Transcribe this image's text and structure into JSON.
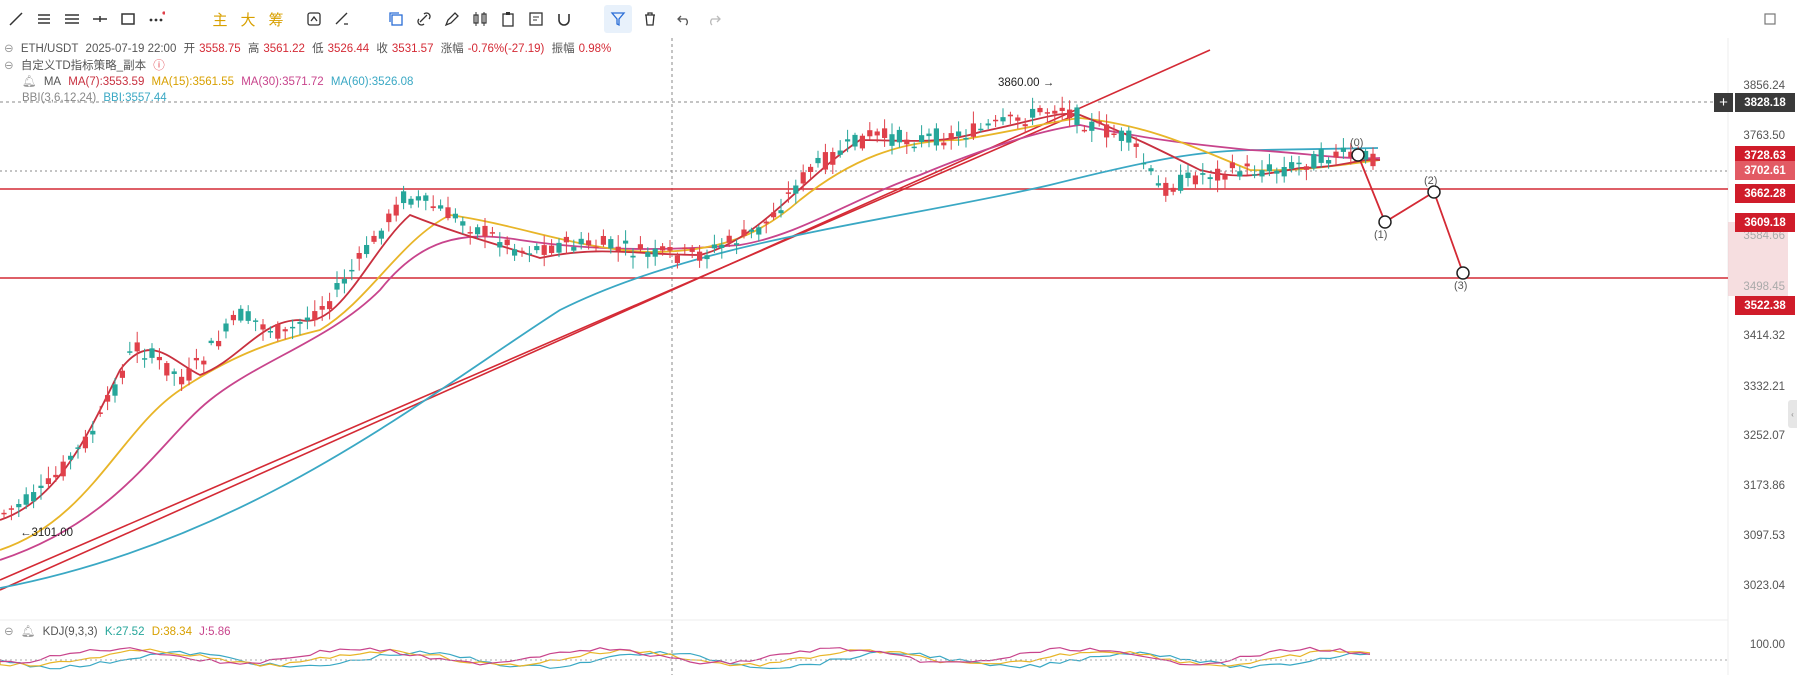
{
  "toolbar": {
    "tools": [
      "trend-line",
      "horizontal-ray",
      "parallel-channel",
      "horizontal-line",
      "rectangle",
      "more"
    ],
    "main_label": "主",
    "big_label": "大",
    "chip_label": "筹"
  },
  "header": {
    "symbol": "ETH/USDT",
    "datetime": "2025-07-19 22:00",
    "open_label": "开",
    "open": "3558.75",
    "high_label": "高",
    "high": "3561.22",
    "low_label": "低",
    "low": "3526.44",
    "close_label": "收",
    "close": "3531.57",
    "change_label": "涨幅",
    "change": "-0.76%(-27.19)",
    "amp_label": "振幅",
    "amp": "0.98%"
  },
  "indicator_line": "自定义TD指标策略_副本",
  "ma": {
    "label": "MA",
    "ma7": "MA(7):3553.59",
    "ma15": "MA(15):3561.55",
    "ma30": "MA(30):3571.72",
    "ma60": "MA(60):3526.08"
  },
  "bbi": {
    "label": "BBI(3,6,12,24)",
    "value": "BBI:3557.44"
  },
  "price_axis": [
    "3856.24",
    "3763.50",
    "3584.66",
    "3498.45",
    "3414.32",
    "3332.21",
    "3252.07",
    "3173.86",
    "3097.53",
    "3023.04"
  ],
  "price_tags": {
    "cursor": "3828.18",
    "last": "3728.63",
    "mid": "3702.61",
    "level_high": "3662.28",
    "target1": "3609.18",
    "level_low": "3522.38"
  },
  "annotations": {
    "high_note": "3860.00 →",
    "low_note": "←3101.00"
  },
  "wave_labels": [
    "(0)",
    "(1)",
    "(2)",
    "(3)"
  ],
  "kdj": {
    "label": "KDJ(9,3,3)",
    "k": "K:27.52",
    "d": "D:38.34",
    "j": "J:5.86",
    "axis_top": "100.00"
  },
  "colors": {
    "up": "#26a69a",
    "down": "#e0404a",
    "ma7": "#c8303f",
    "ma15": "#e8b528",
    "ma30": "#c8448c",
    "ma60": "#3aa8c4",
    "level": "#d42a35",
    "tag_red": "#d01c2a",
    "tag_pink": "#f0c8cc"
  }
}
